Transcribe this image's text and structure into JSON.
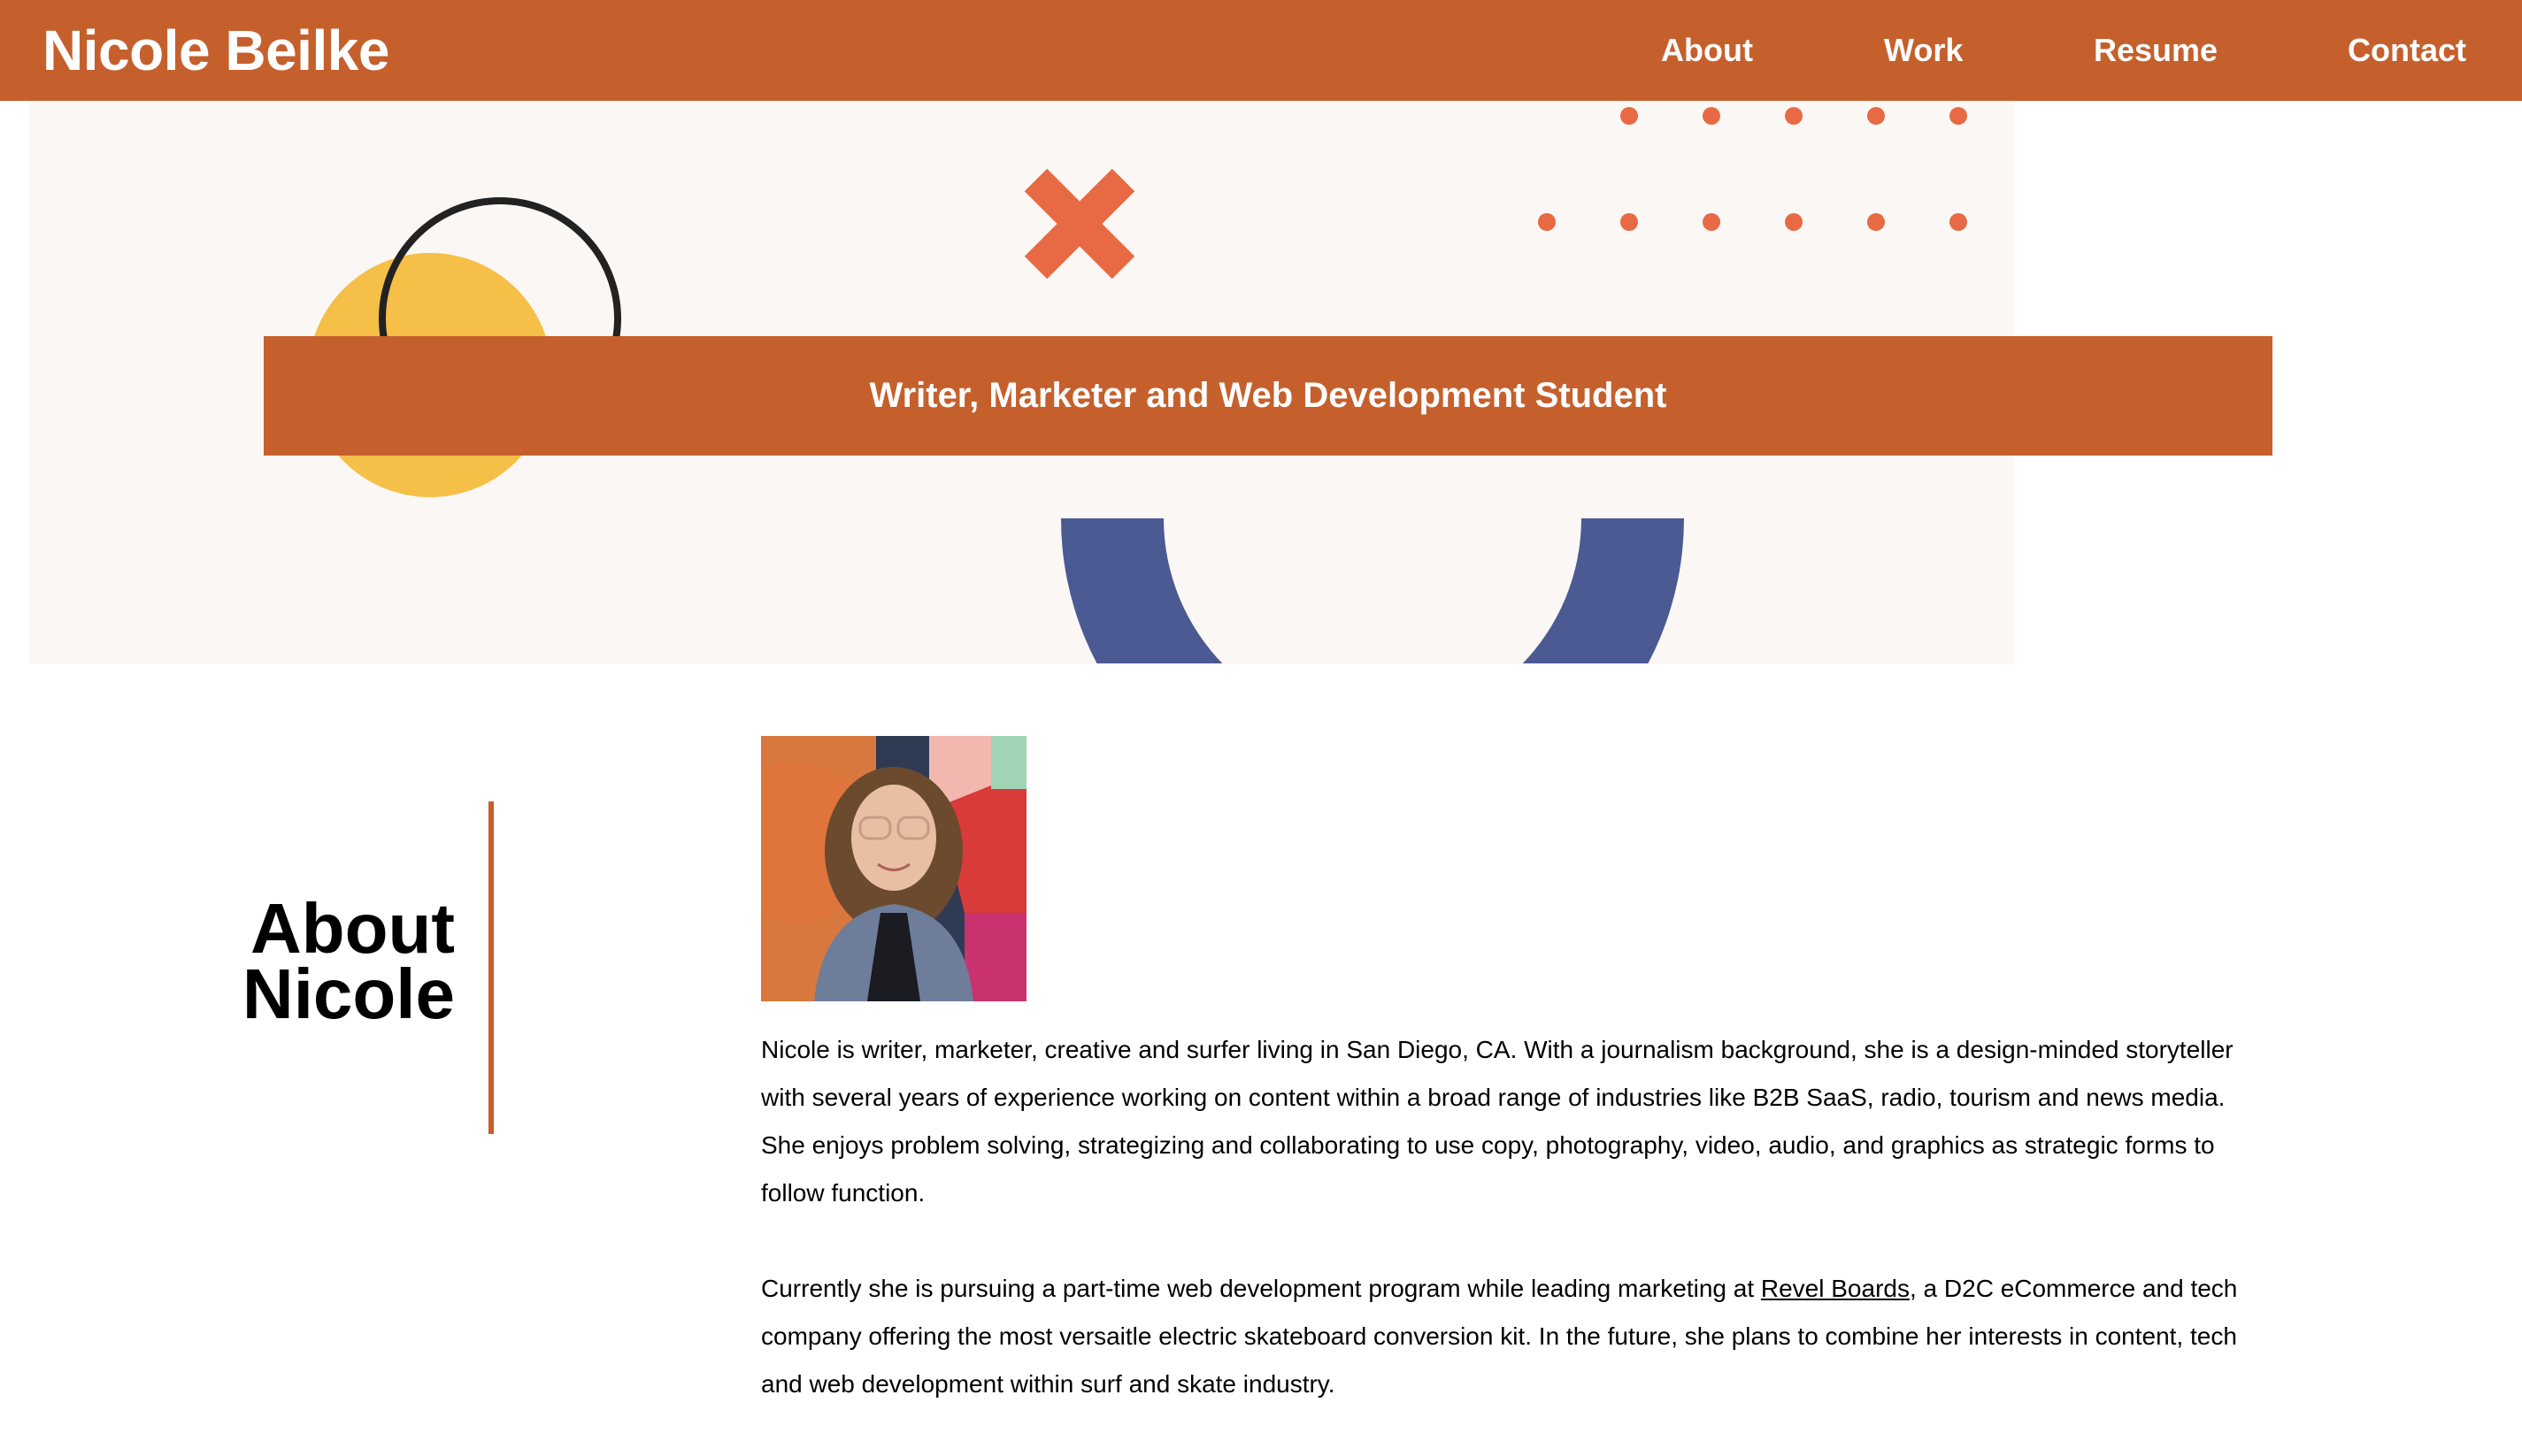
{
  "header": {
    "logo": "Nicole Beilke",
    "nav": [
      {
        "label": "About"
      },
      {
        "label": "Work"
      },
      {
        "label": "Resume"
      },
      {
        "label": "Contact"
      }
    ]
  },
  "hero": {
    "tagline": "Writer, Marketer and Web Development Student"
  },
  "about": {
    "heading_line1": "About",
    "heading_line2": "Nicole",
    "paragraph1": "Nicole is writer, marketer, creative and surfer living in San Diego, CA. With a journalism background, she is a design-minded storyteller with several years of experience working on content within a broad range of industries like B2B SaaS, radio, tourism and news media. She enjoys problem solving, strategizing and collaborating to use copy, photography, video, audio, and graphics as strategic forms to follow function.",
    "paragraph2_before": "Currently she is pursuing a part-time web development program while leading marketing at ",
    "paragraph2_link": "Revel Boards",
    "paragraph2_after": ", a D2C eCommerce and tech company offering the most versaitle electric skateboard conversion kit. In the future, she plans to combine her interests in content, tech and web development within surf and skate industry."
  },
  "colors": {
    "brand": "#c5602d",
    "hero_background": "#fbf7f4",
    "accent_orange": "#e76a44",
    "accent_yellow": "#f5bf48",
    "accent_blue": "#4b5a93",
    "ring_dark": "#222222"
  }
}
